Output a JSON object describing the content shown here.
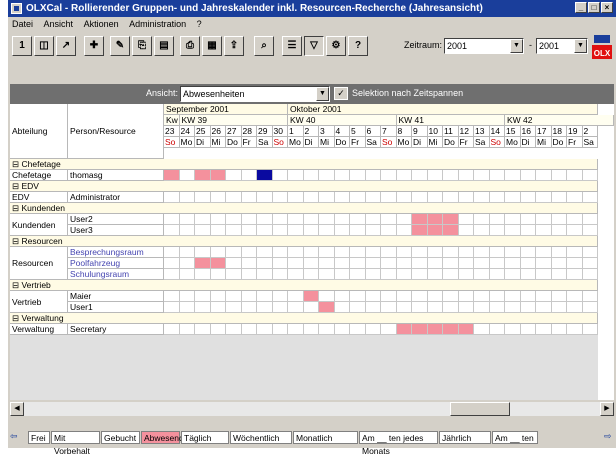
{
  "window": {
    "title": "OLXCal - Rollierender Gruppen- und Jahreskalender inkl. Resourcen-Recherche   (Jahresansicht)"
  },
  "menu": [
    "Datei",
    "Ansicht",
    "Aktionen",
    "Administration",
    "?"
  ],
  "toolbar": {
    "zeitraum_label": "Zeitraum:",
    "from_year": "2001",
    "sep": "-",
    "to_year": "2001",
    "logo_text": "OLX"
  },
  "view": {
    "label": "Ansicht:",
    "selected": "Abwesenheiten",
    "selection_label": "Selektion nach Zeitspannen"
  },
  "grid": {
    "col_headers": {
      "dept": "Abteilung",
      "person": "Person/Resource"
    },
    "months": [
      {
        "label": "September 2001",
        "start": 0
      },
      {
        "label": "Oktober 2001",
        "start": 8
      }
    ],
    "weeks": [
      {
        "label": "Kw",
        "start": 0,
        "span": 1
      },
      {
        "label": "KW 39",
        "start": 1,
        "span": 7
      },
      {
        "label": "KW 40",
        "start": 8,
        "span": 7
      },
      {
        "label": "KW 41",
        "start": 15,
        "span": 7
      },
      {
        "label": "KW 42",
        "start": 22,
        "span": 7
      }
    ],
    "days": [
      "23",
      "24",
      "25",
      "26",
      "27",
      "28",
      "29",
      "30",
      "1",
      "2",
      "3",
      "4",
      "5",
      "6",
      "7",
      "8",
      "9",
      "10",
      "11",
      "12",
      "13",
      "14",
      "15",
      "16",
      "17",
      "18",
      "19",
      "2"
    ],
    "weekdays": [
      "So",
      "Mo",
      "Di",
      "Mi",
      "Do",
      "Fr",
      "Sa",
      "So",
      "Mo",
      "Di",
      "Mi",
      "Do",
      "Fr",
      "Sa",
      "So",
      "Mo",
      "Di",
      "Mi",
      "Do",
      "Fr",
      "Sa",
      "So",
      "Mo",
      "Di",
      "Mi",
      "Do",
      "Fr",
      "Sa"
    ],
    "rows": [
      {
        "type": "group",
        "label": "Chefetage",
        "toggle": "⊟"
      },
      {
        "type": "person",
        "dept": "Chefetage",
        "person": "thomasg",
        "abs": [
          0,
          2,
          3
        ],
        "busy": [
          6
        ]
      },
      {
        "type": "group",
        "label": "EDV",
        "toggle": "⊟"
      },
      {
        "type": "person",
        "dept": "EDV",
        "person": "Administrator",
        "abs": [],
        "busy": []
      },
      {
        "type": "group",
        "label": "Kundenden",
        "toggle": "⊟"
      },
      {
        "type": "multi",
        "dept": "Kundenden",
        "people": [
          "User2",
          "User3"
        ],
        "abs": [
          [
            16,
            17,
            18
          ],
          [
            16,
            17,
            18
          ]
        ]
      },
      {
        "type": "group",
        "label": "Resourcen",
        "toggle": "⊟"
      },
      {
        "type": "multi3",
        "dept": "Resourcen",
        "people": [
          "Besprechungsraum",
          "Poolfahrzeug",
          "Schulungsraum"
        ],
        "abs": [
          [],
          [
            2,
            3
          ],
          []
        ]
      },
      {
        "type": "group",
        "label": "Vertrieb",
        "toggle": "⊟"
      },
      {
        "type": "multi",
        "dept": "Vertrieb",
        "people": [
          "Maier",
          "User1"
        ],
        "abs": [
          [
            9
          ],
          [
            10
          ]
        ]
      },
      {
        "type": "group",
        "label": "Verwaltung",
        "toggle": "⊟"
      },
      {
        "type": "person",
        "dept": "Verwaltung",
        "person": "Secretary",
        "abs": [
          15,
          16,
          17,
          18,
          19
        ],
        "busy": []
      }
    ]
  },
  "legend": [
    {
      "label": "Frei",
      "color": "#ffffff"
    },
    {
      "label": "Mit Vorbehalt",
      "color": "#ffffff"
    },
    {
      "label": "Gebucht",
      "color": "#ffffff"
    },
    {
      "label": "Abwesend",
      "color": "#f4919d"
    },
    {
      "label": "Täglich",
      "color": "#ffffff"
    },
    {
      "label": "Wöchentlich",
      "color": "#ffffff"
    },
    {
      "label": "Monatlich",
      "color": "#ffffff"
    },
    {
      "label": "Am __ ten jedes Monats",
      "color": "#ffffff"
    },
    {
      "label": "Jährlich",
      "color": "#ffffff"
    },
    {
      "label": "Am __ ten",
      "color": "#ffffff"
    }
  ],
  "colors": {
    "absent": "#f4919d",
    "booked": "#0a0aa0",
    "titlebar": "#1a3e9b",
    "weekend_text": "#cc0000"
  }
}
